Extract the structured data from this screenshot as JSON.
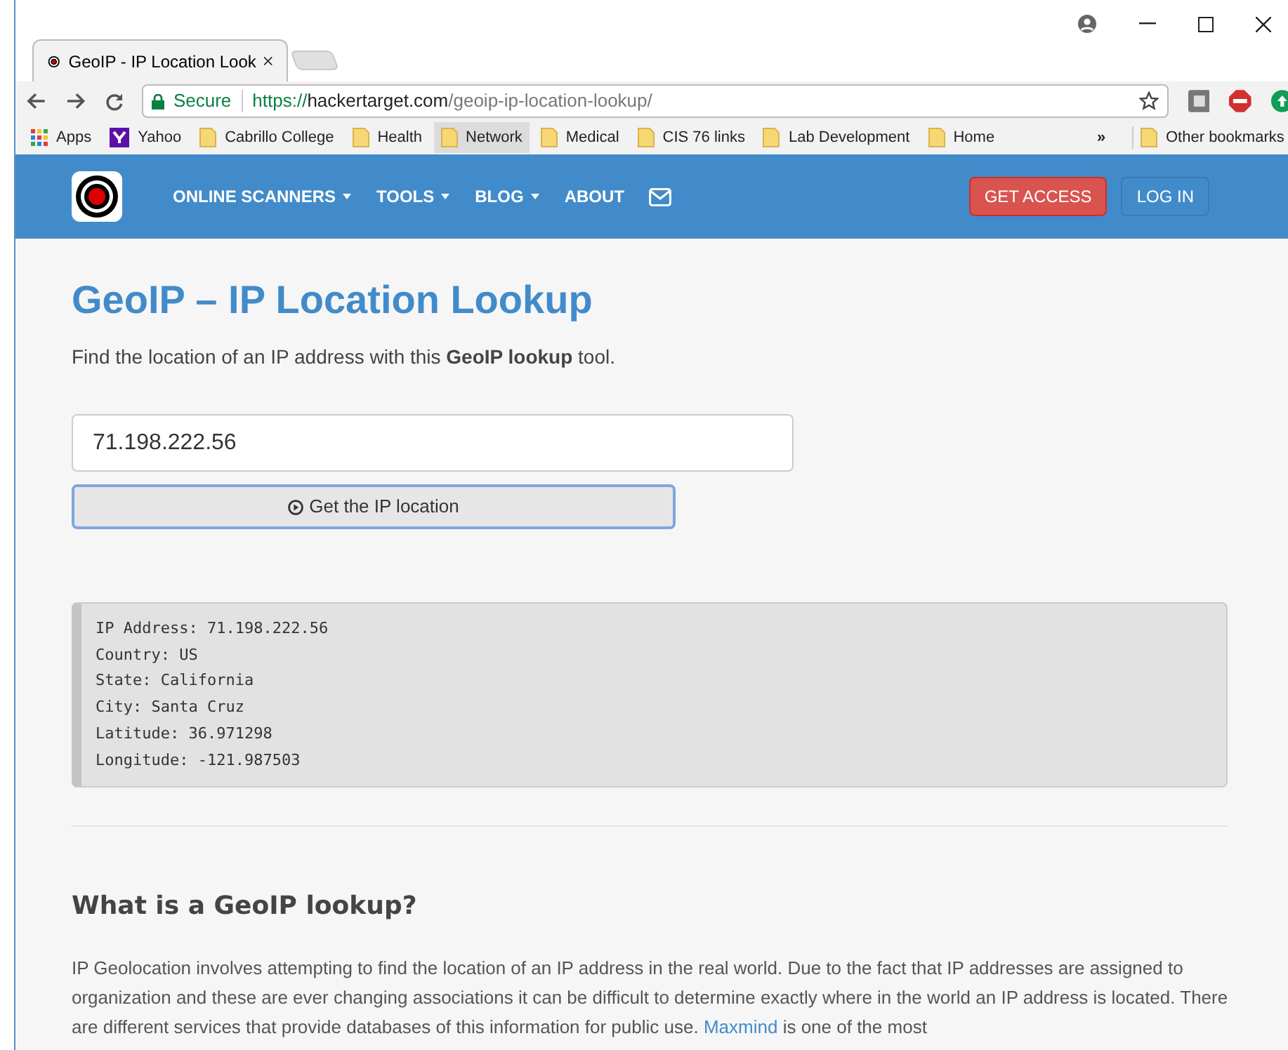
{
  "browser": {
    "tabs": [
      {
        "title": "GeoIP - IP Location Look",
        "selected": true
      }
    ],
    "address": {
      "secure_label": "Secure",
      "scheme": "https://",
      "host": "hackertarget.com",
      "path": "/geoip-ip-location-lookup/"
    },
    "bookmarks": [
      {
        "label": "Apps",
        "kind": "apps",
        "selected": false
      },
      {
        "label": "Yahoo",
        "kind": "yahoo",
        "selected": false
      },
      {
        "label": "Cabrillo College",
        "kind": "folder",
        "selected": false
      },
      {
        "label": "Health",
        "kind": "folder",
        "selected": false
      },
      {
        "label": "Network",
        "kind": "folder",
        "selected": true
      },
      {
        "label": "Medical",
        "kind": "folder",
        "selected": false
      },
      {
        "label": "CIS 76 links",
        "kind": "folder",
        "selected": false
      },
      {
        "label": "Lab Development",
        "kind": "folder",
        "selected": false
      },
      {
        "label": "Home",
        "kind": "folder",
        "selected": false
      }
    ],
    "more": "»",
    "other_bookmarks": "Other bookmarks"
  },
  "nav": {
    "items": [
      "ONLINE SCANNERS",
      "TOOLS",
      "BLOG",
      "ABOUT"
    ],
    "dropdown": [
      true,
      true,
      true,
      false
    ],
    "get_access": "GET ACCESS",
    "log_in": "LOG IN"
  },
  "heading": "GeoIP – IP Location Lookup",
  "intro": "Find the location of an IP address with this **GeoIP lookup** tool.",
  "ip_field": {
    "value": "71.198.222.56"
  },
  "submit": "Get the IP location",
  "result": [
    "IP Address: 71.198.222.56",
    "Country: US",
    "State: California",
    "City: Santa Cruz",
    "Latitude: 36.971298",
    "Longitude: -121.987503"
  ],
  "section_title": "What is a GeoIP lookup?",
  "body": {
    "before": "IP Geolocation involves attempting to find the location of an IP address in the real world. Due to the fact that IP addresses are assigned to organization and these are ever changing associations it can be difficult to determine exactly where in the world an IP address is located. There are different services that provide databases of this information for public use.",
    "link": "Maxmind",
    "after": "is one of the most"
  }
}
